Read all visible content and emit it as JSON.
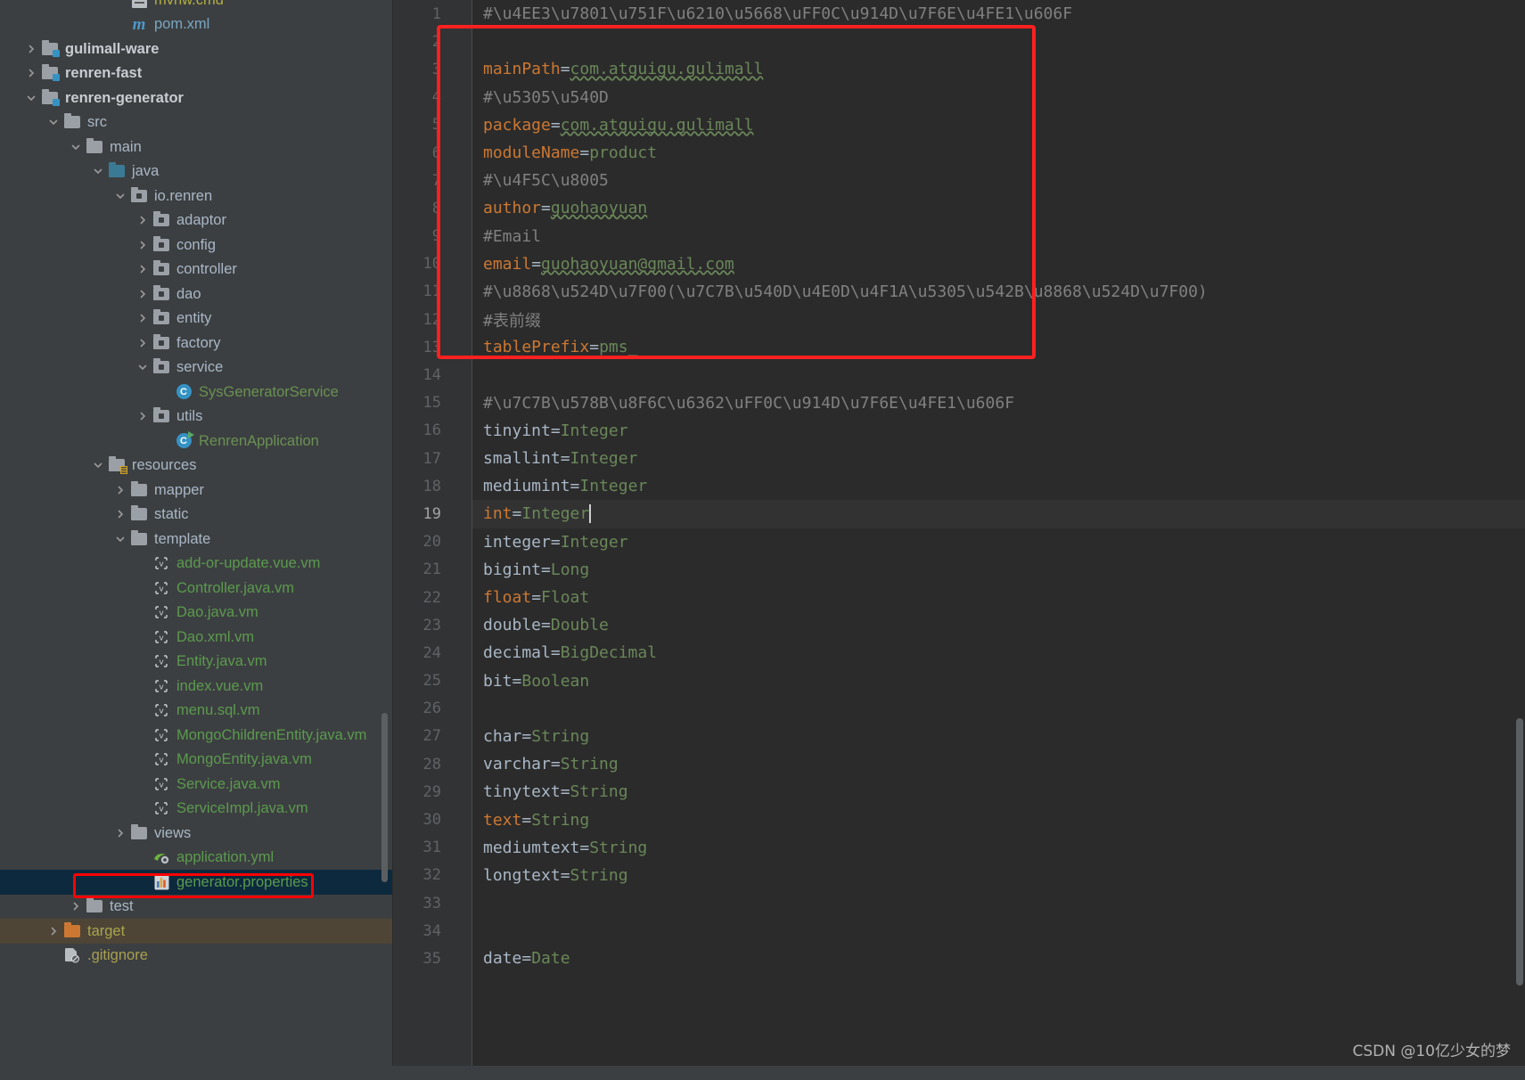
{
  "window": {
    "watermark": "CSDN @10亿少女的梦"
  },
  "project_tree": {
    "name": "Project tool window",
    "items": [
      {
        "label": "mvnw.cmd",
        "indent": 5,
        "arrow": "none",
        "icon": "file-doc-icon",
        "color": "c-yellow",
        "partial": true
      },
      {
        "label": "pom.xml",
        "indent": 5,
        "arrow": "none",
        "icon": "maven-icon",
        "color": "c-blue"
      },
      {
        "label": "gulimall-ware",
        "indent": 1,
        "arrow": "collapsed",
        "icon": "module-folder-icon",
        "color": "c-bold"
      },
      {
        "label": "renren-fast",
        "indent": 1,
        "arrow": "collapsed",
        "icon": "module-folder-icon",
        "color": "c-bold"
      },
      {
        "label": "renren-generator",
        "indent": 1,
        "arrow": "expanded",
        "icon": "module-folder-icon",
        "color": "c-bold"
      },
      {
        "label": "src",
        "indent": 2,
        "arrow": "expanded",
        "icon": "folder-icon",
        "color": "c-gray"
      },
      {
        "label": "main",
        "indent": 3,
        "arrow": "expanded",
        "icon": "folder-icon",
        "color": "c-gray"
      },
      {
        "label": "java",
        "indent": 4,
        "arrow": "expanded",
        "icon": "source-folder-icon",
        "color": "c-gray"
      },
      {
        "label": "io.renren",
        "indent": 5,
        "arrow": "expanded",
        "icon": "package-icon",
        "color": "c-gray"
      },
      {
        "label": "adaptor",
        "indent": 6,
        "arrow": "collapsed",
        "icon": "package-icon",
        "color": "c-gray"
      },
      {
        "label": "config",
        "indent": 6,
        "arrow": "collapsed",
        "icon": "package-icon",
        "color": "c-gray"
      },
      {
        "label": "controller",
        "indent": 6,
        "arrow": "collapsed",
        "icon": "package-icon",
        "color": "c-gray"
      },
      {
        "label": "dao",
        "indent": 6,
        "arrow": "collapsed",
        "icon": "package-icon",
        "color": "c-gray"
      },
      {
        "label": "entity",
        "indent": 6,
        "arrow": "collapsed",
        "icon": "package-icon",
        "color": "c-gray"
      },
      {
        "label": "factory",
        "indent": 6,
        "arrow": "collapsed",
        "icon": "package-icon",
        "color": "c-gray"
      },
      {
        "label": "service",
        "indent": 6,
        "arrow": "expanded",
        "icon": "package-icon",
        "color": "c-gray"
      },
      {
        "label": "SysGeneratorService",
        "indent": 7,
        "arrow": "none",
        "icon": "class-icon",
        "color": "c-green"
      },
      {
        "label": "utils",
        "indent": 6,
        "arrow": "collapsed",
        "icon": "package-icon",
        "color": "c-gray"
      },
      {
        "label": "RenrenApplication",
        "indent": 7,
        "arrow": "none",
        "icon": "runnable-class-icon",
        "color": "c-green"
      },
      {
        "label": "resources",
        "indent": 4,
        "arrow": "expanded",
        "icon": "resources-folder-icon",
        "color": "c-gray"
      },
      {
        "label": "mapper",
        "indent": 5,
        "arrow": "collapsed",
        "icon": "folder-icon",
        "color": "c-gray"
      },
      {
        "label": "static",
        "indent": 5,
        "arrow": "collapsed",
        "icon": "folder-icon",
        "color": "c-gray"
      },
      {
        "label": "template",
        "indent": 5,
        "arrow": "expanded",
        "icon": "folder-icon",
        "color": "c-gray"
      },
      {
        "label": "add-or-update.vue.vm",
        "indent": 6,
        "arrow": "none",
        "icon": "velocity-file-icon",
        "color": "c-greeny"
      },
      {
        "label": "Controller.java.vm",
        "indent": 6,
        "arrow": "none",
        "icon": "velocity-file-icon",
        "color": "c-greeny"
      },
      {
        "label": "Dao.java.vm",
        "indent": 6,
        "arrow": "none",
        "icon": "velocity-file-icon",
        "color": "c-greeny"
      },
      {
        "label": "Dao.xml.vm",
        "indent": 6,
        "arrow": "none",
        "icon": "velocity-file-icon",
        "color": "c-greeny"
      },
      {
        "label": "Entity.java.vm",
        "indent": 6,
        "arrow": "none",
        "icon": "velocity-file-icon",
        "color": "c-greeny"
      },
      {
        "label": "index.vue.vm",
        "indent": 6,
        "arrow": "none",
        "icon": "velocity-file-icon",
        "color": "c-greeny"
      },
      {
        "label": "menu.sql.vm",
        "indent": 6,
        "arrow": "none",
        "icon": "velocity-file-icon",
        "color": "c-greeny"
      },
      {
        "label": "MongoChildrenEntity.java.vm",
        "indent": 6,
        "arrow": "none",
        "icon": "velocity-file-icon",
        "color": "c-greeny"
      },
      {
        "label": "MongoEntity.java.vm",
        "indent": 6,
        "arrow": "none",
        "icon": "velocity-file-icon",
        "color": "c-greeny"
      },
      {
        "label": "Service.java.vm",
        "indent": 6,
        "arrow": "none",
        "icon": "velocity-file-icon",
        "color": "c-greeny"
      },
      {
        "label": "ServiceImpl.java.vm",
        "indent": 6,
        "arrow": "none",
        "icon": "velocity-file-icon",
        "color": "c-greeny"
      },
      {
        "label": "views",
        "indent": 5,
        "arrow": "collapsed",
        "icon": "folder-icon",
        "color": "c-gray"
      },
      {
        "label": "application.yml",
        "indent": 6,
        "arrow": "none",
        "icon": "spring-yaml-icon",
        "color": "c-greeny"
      },
      {
        "label": "generator.properties",
        "indent": 6,
        "arrow": "none",
        "icon": "properties-icon",
        "color": "c-greeny",
        "state": "selected"
      },
      {
        "label": "test",
        "indent": 3,
        "arrow": "collapsed",
        "icon": "folder-icon",
        "color": "c-gray"
      },
      {
        "label": "target",
        "indent": 2,
        "arrow": "collapsed",
        "icon": "excluded-folder-icon",
        "color": "c-tgt",
        "state": "target"
      },
      {
        "label": ".gitignore",
        "indent": 2,
        "arrow": "none",
        "icon": "gitignore-icon",
        "color": "c-olive"
      }
    ]
  },
  "editor": {
    "name": "generator.properties editor",
    "current_line": 19,
    "first_line": 1,
    "lines": [
      {
        "n": 1,
        "tokens": [
          {
            "t": "#\\u4EE3\\u7801\\u751F\\u6210\\u5668\\uFF0C\\u914D\\u7F6E\\u4FE1\\u606F",
            "c": "cmt"
          }
        ]
      },
      {
        "n": 2,
        "tokens": []
      },
      {
        "n": 3,
        "tokens": [
          {
            "t": "mainPath",
            "c": "key"
          },
          {
            "t": "=",
            "c": "eq"
          },
          {
            "t": "com.atguigu.gulimall",
            "c": "val-sq"
          }
        ]
      },
      {
        "n": 4,
        "tokens": [
          {
            "t": "#\\u5305\\u540D",
            "c": "cmt"
          }
        ]
      },
      {
        "n": 5,
        "tokens": [
          {
            "t": "package",
            "c": "key"
          },
          {
            "t": "=",
            "c": "eq"
          },
          {
            "t": "com.atguigu.gulimall",
            "c": "val-sq"
          }
        ]
      },
      {
        "n": 6,
        "tokens": [
          {
            "t": "moduleName",
            "c": "key"
          },
          {
            "t": "=",
            "c": "eq"
          },
          {
            "t": "product",
            "c": "val"
          }
        ]
      },
      {
        "n": 7,
        "tokens": [
          {
            "t": "#\\u4F5C\\u8005",
            "c": "cmt"
          }
        ]
      },
      {
        "n": 8,
        "tokens": [
          {
            "t": "author",
            "c": "key"
          },
          {
            "t": "=",
            "c": "eq"
          },
          {
            "t": "guohaoyuan",
            "c": "val-sq"
          }
        ]
      },
      {
        "n": 9,
        "tokens": [
          {
            "t": "#Email",
            "c": "cmt"
          }
        ]
      },
      {
        "n": 10,
        "tokens": [
          {
            "t": "email",
            "c": "key"
          },
          {
            "t": "=",
            "c": "eq"
          },
          {
            "t": "guohaoyuan@gmail.com",
            "c": "val-sq"
          }
        ]
      },
      {
        "n": 11,
        "tokens": [
          {
            "t": "#\\u8868\\u524D\\u7F00(\\u7C7B\\u540D\\u4E0D\\u4F1A\\u5305\\u542B\\u8868\\u524D\\u7F00)",
            "c": "cmt"
          }
        ]
      },
      {
        "n": 12,
        "tokens": [
          {
            "t": "#表前缀",
            "c": "cmt"
          }
        ]
      },
      {
        "n": 13,
        "tokens": [
          {
            "t": "tablePrefix",
            "c": "key"
          },
          {
            "t": "=",
            "c": "eq"
          },
          {
            "t": "pms_",
            "c": "val"
          }
        ]
      },
      {
        "n": 14,
        "tokens": []
      },
      {
        "n": 15,
        "tokens": [
          {
            "t": "#\\u7C7B\\u578B\\u8F6C\\u6362\\uFF0C\\u914D\\u7F6E\\u4FE1\\u606F",
            "c": "cmt"
          }
        ]
      },
      {
        "n": 16,
        "tokens": [
          {
            "t": "tinyint",
            "c": "plain"
          },
          {
            "t": "=",
            "c": "eq"
          },
          {
            "t": "Integer",
            "c": "val"
          }
        ]
      },
      {
        "n": 17,
        "tokens": [
          {
            "t": "smallint",
            "c": "plain"
          },
          {
            "t": "=",
            "c": "eq"
          },
          {
            "t": "Integer",
            "c": "val"
          }
        ]
      },
      {
        "n": 18,
        "tokens": [
          {
            "t": "mediumint",
            "c": "plain"
          },
          {
            "t": "=",
            "c": "eq"
          },
          {
            "t": "Integer",
            "c": "val"
          }
        ]
      },
      {
        "n": 19,
        "tokens": [
          {
            "t": "int",
            "c": "key"
          },
          {
            "t": "=",
            "c": "eq"
          },
          {
            "t": "Integer",
            "c": "val"
          }
        ],
        "caret": true
      },
      {
        "n": 20,
        "tokens": [
          {
            "t": "integer",
            "c": "plain"
          },
          {
            "t": "=",
            "c": "eq"
          },
          {
            "t": "Integer",
            "c": "val"
          }
        ]
      },
      {
        "n": 21,
        "tokens": [
          {
            "t": "bigint",
            "c": "plain"
          },
          {
            "t": "=",
            "c": "eq"
          },
          {
            "t": "Long",
            "c": "val"
          }
        ]
      },
      {
        "n": 22,
        "tokens": [
          {
            "t": "float",
            "c": "key"
          },
          {
            "t": "=",
            "c": "eq"
          },
          {
            "t": "Float",
            "c": "val"
          }
        ]
      },
      {
        "n": 23,
        "tokens": [
          {
            "t": "double",
            "c": "plain"
          },
          {
            "t": "=",
            "c": "eq"
          },
          {
            "t": "Double",
            "c": "val"
          }
        ]
      },
      {
        "n": 24,
        "tokens": [
          {
            "t": "decimal",
            "c": "plain"
          },
          {
            "t": "=",
            "c": "eq"
          },
          {
            "t": "BigDecimal",
            "c": "val"
          }
        ]
      },
      {
        "n": 25,
        "tokens": [
          {
            "t": "bit",
            "c": "plain"
          },
          {
            "t": "=",
            "c": "eq"
          },
          {
            "t": "Boolean",
            "c": "val"
          }
        ]
      },
      {
        "n": 26,
        "tokens": []
      },
      {
        "n": 27,
        "tokens": [
          {
            "t": "char",
            "c": "plain"
          },
          {
            "t": "=",
            "c": "eq"
          },
          {
            "t": "String",
            "c": "val"
          }
        ]
      },
      {
        "n": 28,
        "tokens": [
          {
            "t": "varchar",
            "c": "plain"
          },
          {
            "t": "=",
            "c": "eq"
          },
          {
            "t": "String",
            "c": "val"
          }
        ]
      },
      {
        "n": 29,
        "tokens": [
          {
            "t": "tinytext",
            "c": "plain"
          },
          {
            "t": "=",
            "c": "eq"
          },
          {
            "t": "String",
            "c": "val"
          }
        ]
      },
      {
        "n": 30,
        "tokens": [
          {
            "t": "text",
            "c": "key"
          },
          {
            "t": "=",
            "c": "eq"
          },
          {
            "t": "String",
            "c": "val"
          }
        ]
      },
      {
        "n": 31,
        "tokens": [
          {
            "t": "mediumtext",
            "c": "plain"
          },
          {
            "t": "=",
            "c": "eq"
          },
          {
            "t": "String",
            "c": "val"
          }
        ]
      },
      {
        "n": 32,
        "tokens": [
          {
            "t": "longtext",
            "c": "plain"
          },
          {
            "t": "=",
            "c": "eq"
          },
          {
            "t": "String",
            "c": "val"
          }
        ]
      },
      {
        "n": 33,
        "tokens": []
      },
      {
        "n": 34,
        "tokens": []
      },
      {
        "n": 35,
        "tokens": [
          {
            "t": "date",
            "c": "plain"
          },
          {
            "t": "=",
            "c": "eq"
          },
          {
            "t": "Date",
            "c": "val"
          }
        ]
      }
    ]
  },
  "annotations": {
    "code_box_label": "red-rectangle-config-block",
    "tree_box_label": "red-rectangle-generator-properties",
    "color": "#ff0000"
  }
}
